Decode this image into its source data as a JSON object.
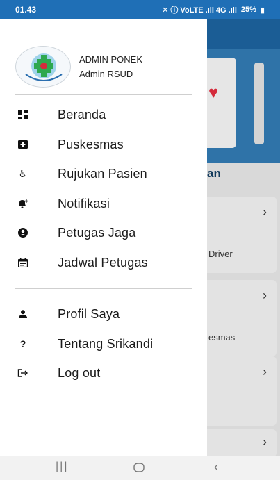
{
  "status_bar": {
    "time": "01.43",
    "indicators": "✕ ⓘ VoLTE .ıll 4G .ıll",
    "battery": "25%"
  },
  "background_app": {
    "section_title": "an",
    "cards": [
      {
        "text": "Driver"
      },
      {
        "text": "esmas"
      },
      {
        "text": ""
      },
      {
        "text": ""
      }
    ]
  },
  "drawer": {
    "user": {
      "name": "ADMIN PONEK",
      "role": "Admin RSUD"
    },
    "menu": [
      {
        "label": "Beranda",
        "icon": "dashboard-icon"
      },
      {
        "label": "Puskesmas",
        "icon": "hospital-icon"
      },
      {
        "label": "Rujukan Pasien",
        "icon": "wheelchair-icon"
      },
      {
        "label": "Notifikasi",
        "icon": "bell-add-icon"
      },
      {
        "label": "Petugas Jaga",
        "icon": "user-circle-icon"
      },
      {
        "label": "Jadwal Petugas",
        "icon": "calendar-icon"
      }
    ],
    "menu_secondary": [
      {
        "label": "Profil Saya",
        "icon": "person-icon"
      },
      {
        "label": "Tentang Srikandi",
        "icon": "question-icon"
      },
      {
        "label": "Log out",
        "icon": "logout-icon"
      }
    ]
  },
  "colors": {
    "status_bar": "#1f6fb6",
    "app_bar": "#1b5d95",
    "drawer_bg": "#ffffff",
    "scrim": "#d9d9d9"
  }
}
